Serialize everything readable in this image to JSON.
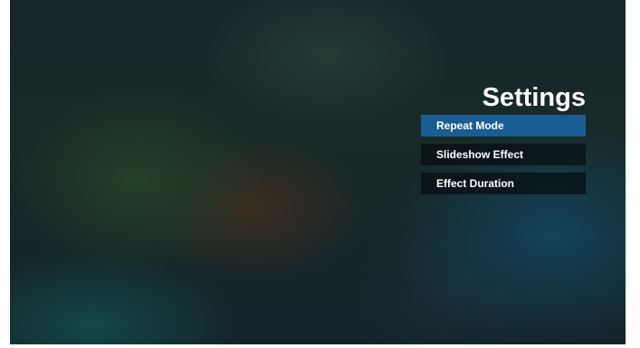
{
  "settings": {
    "title": "Settings",
    "items": [
      {
        "label": "Repeat Mode",
        "selected": true
      },
      {
        "label": "Slideshow Effect",
        "selected": false
      },
      {
        "label": "Effect Duration",
        "selected": false
      }
    ]
  },
  "colors": {
    "selected_item": "#1a5d92",
    "item_background": "#0a1418",
    "text": "#ffffff"
  }
}
